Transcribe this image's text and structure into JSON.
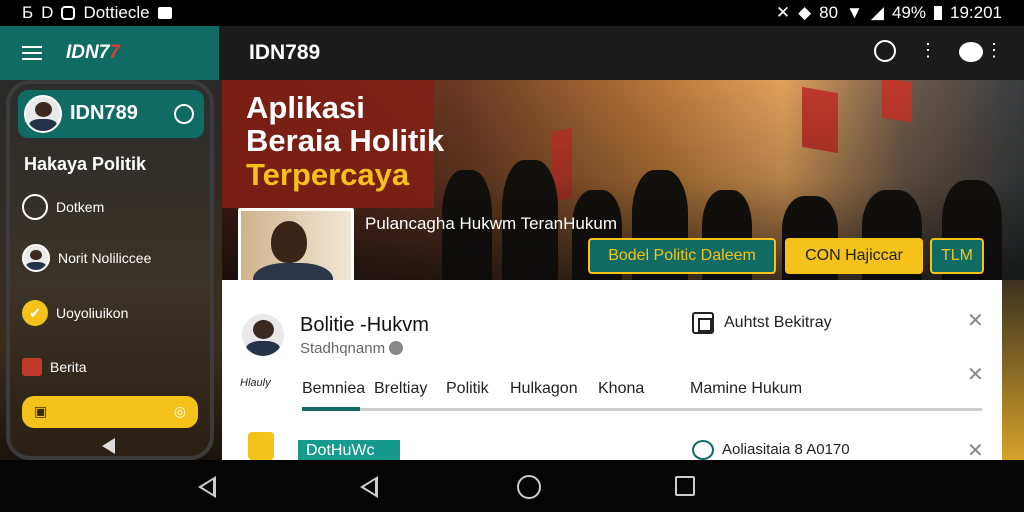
{
  "status_bar": {
    "left_text": "Dottiecle",
    "clock": "19:201",
    "battery": "49%",
    "signal_text": "80"
  },
  "app_bar": {
    "logo": "IDN7",
    "title": "IDN789"
  },
  "drawer": {
    "brand": "IDN789",
    "heading": "Hakaya Politik",
    "items": [
      {
        "label": "Dotkem"
      },
      {
        "label": "Norit Noliliccee"
      },
      {
        "label": "Uoyoliuikon"
      },
      {
        "label": "Berita"
      }
    ]
  },
  "hero": {
    "title_line1": "Aplikasi",
    "title_line2": "Beraia Holitik",
    "title_line3": "Terpercaya",
    "subtitle": "Pulancagha Hukwm TeranHukum",
    "buttons": [
      {
        "label": "Bodel Politic Daleem"
      },
      {
        "label": "CON Hajiccar"
      },
      {
        "label": "TLM"
      }
    ]
  },
  "card": {
    "title": "Bolitie -Hukvm",
    "subtitle": "Stadhqnanm",
    "aux_label": "Auhtst Bekitray",
    "small_logo": "Hlauly",
    "tabs": [
      "Bemniea",
      "Breltiay",
      "Politik",
      "Hulkagon",
      "Khona",
      "Mamine Hukum"
    ],
    "footer_button": "DotHuWc",
    "footer_text": "Aoliasitaia 8 A0170"
  },
  "colors": {
    "teal": "#0f6b63",
    "yellow": "#f4c21b",
    "red": "#c0392b"
  }
}
